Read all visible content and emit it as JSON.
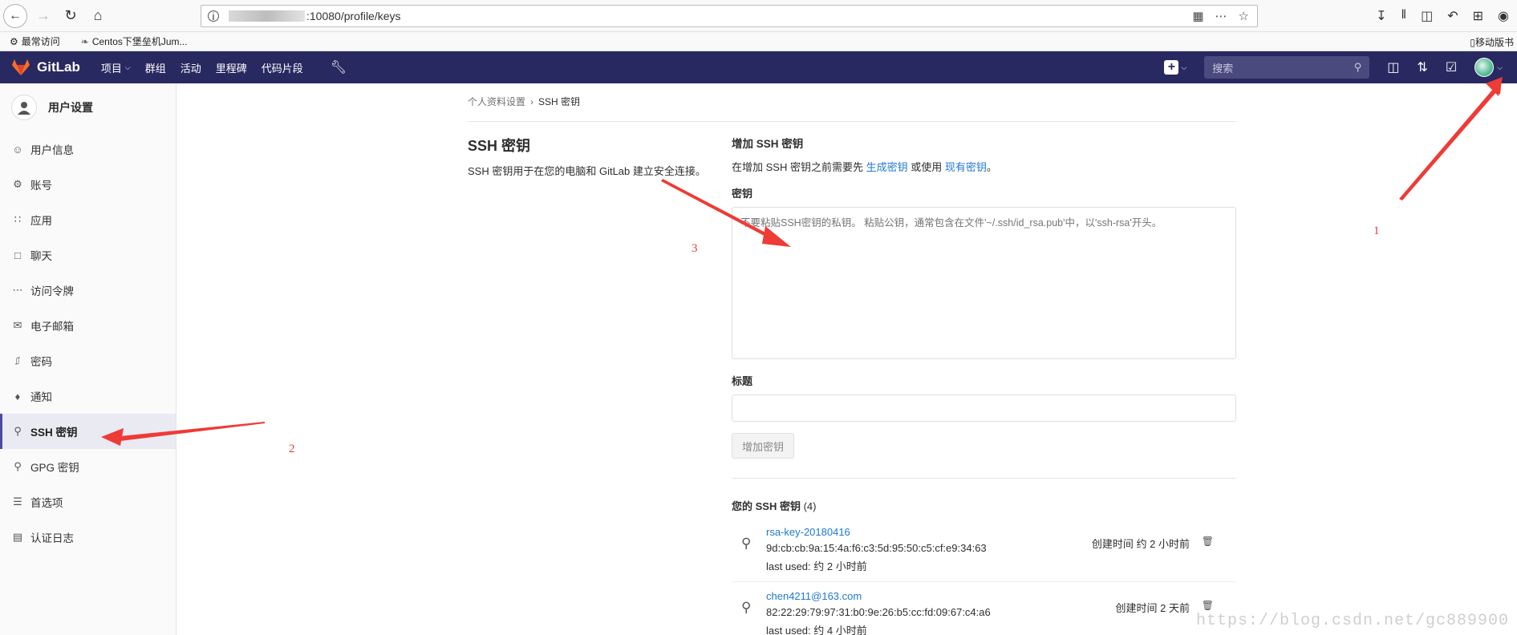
{
  "browser": {
    "url_suffix": ":10080/profile/keys",
    "bookmarks": [
      "最常访问",
      "Centos下堡垒机Jum..."
    ],
    "right_bookmark": "移动版书"
  },
  "gitlab": {
    "brand": "GitLab",
    "menu": [
      "项目",
      "群组",
      "活动",
      "里程碑",
      "代码片段"
    ],
    "search_placeholder": "搜索"
  },
  "sidebar": {
    "title": "用户设置",
    "items": [
      {
        "label": "用户信息",
        "icon": "user-circle-icon"
      },
      {
        "label": "账号",
        "icon": "user-gear-icon"
      },
      {
        "label": "应用",
        "icon": "apps-grid-icon"
      },
      {
        "label": "聊天",
        "icon": "chat-bubble-icon"
      },
      {
        "label": "访问令牌",
        "icon": "token-icon"
      },
      {
        "label": "电子邮箱",
        "icon": "envelope-icon"
      },
      {
        "label": "密码",
        "icon": "lock-icon"
      },
      {
        "label": "通知",
        "icon": "bell-icon"
      },
      {
        "label": "SSH 密钥",
        "icon": "key-icon"
      },
      {
        "label": "GPG 密钥",
        "icon": "key-icon"
      },
      {
        "label": "首选项",
        "icon": "sliders-icon"
      },
      {
        "label": "认证日志",
        "icon": "log-icon"
      }
    ],
    "active_index": 8
  },
  "breadcrumb": {
    "parent": "个人资料设置",
    "current": "SSH 密钥"
  },
  "intro": {
    "title": "SSH 密钥",
    "description": "SSH 密钥用于在您的电脑和 GitLab 建立安全连接。"
  },
  "add_form": {
    "heading": "增加 SSH 密钥",
    "hint_prefix": "在增加 SSH 密钥之前需要先",
    "hint_link1": "生成密钥",
    "hint_middle": "或使用",
    "hint_link2": "现有密钥",
    "hint_suffix": "。",
    "key_label": "密钥",
    "key_placeholder": "不要粘贴SSH密钥的私钥。 粘贴公钥，通常包含在文件'~/.ssh/id_rsa.pub'中，以'ssh-rsa'开头。",
    "title_label": "标题",
    "title_value": "",
    "submit_label": "增加密钥"
  },
  "keys": {
    "heading": "您的 SSH 密钥",
    "count": "(4)",
    "items": [
      {
        "name": "rsa-key-20180416",
        "fingerprint": "9d:cb:cb:9a:15:4a:f6:c3:5d:95:50:c5:cf:e9:34:63",
        "last_used": "last used: 约 2 小时前",
        "created": "创建时间 约 2 小时前"
      },
      {
        "name": "chen4211@163.com",
        "fingerprint": "82:22:29:79:97:31:b0:9e:26:b5:cc:fd:09:67:c4:a6",
        "last_used": "last used: 约 4 小时前",
        "created": "创建时间 2 天前"
      }
    ]
  },
  "annotations": [
    "1",
    "2",
    "3"
  ],
  "watermark": "https://blog.csdn.net/gc889900",
  "colors": {
    "header": "#292961",
    "link": "#1f78d1",
    "annotation": "#e0403a"
  }
}
